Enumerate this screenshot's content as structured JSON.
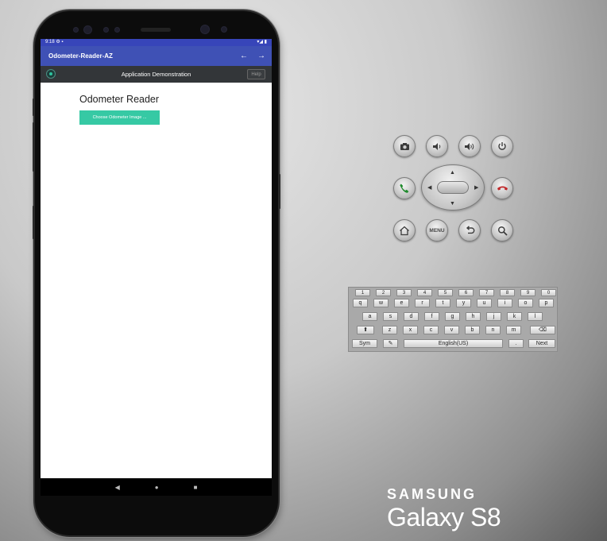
{
  "device": {
    "status_bar": {
      "time": "9:18",
      "icons": "⚙ ▪",
      "right_icons": "▾◢ ▮"
    },
    "nav_bar": {
      "back": "◀",
      "home": "●",
      "recents": "■"
    },
    "brand": "SAMSUNG",
    "model": "Galaxy S8"
  },
  "app": {
    "title": "Odometer-Reader-AZ",
    "back_arrow": "←",
    "forward_arrow": "→",
    "toolbar_title": "Application Demonstration",
    "help_label": "Help",
    "heading": "Odometer Reader",
    "choose_button_label": "Choose Odometer Image ..."
  },
  "controls": {
    "menu_label": "MENU",
    "icons": [
      "camera-icon",
      "volume-down-icon",
      "volume-up-icon",
      "power-icon",
      "call-icon",
      "end-call-icon",
      "home-icon",
      "back-icon",
      "search-icon"
    ]
  },
  "keyboard": {
    "row_numbers": [
      "1",
      "2",
      "3",
      "4",
      "5",
      "6",
      "7",
      "8",
      "9",
      "0"
    ],
    "row1": [
      "q",
      "w",
      "e",
      "r",
      "t",
      "y",
      "u",
      "i",
      "o",
      "p"
    ],
    "row2": [
      "a",
      "s",
      "d",
      "f",
      "g",
      "h",
      "j",
      "k",
      "l"
    ],
    "row3": [
      "z",
      "x",
      "c",
      "v",
      "b",
      "n",
      "m"
    ],
    "shift": "⬆",
    "delete": "⌫",
    "sym": "Sym",
    "space": "English(US)",
    "period": ".",
    "next": "Next"
  }
}
